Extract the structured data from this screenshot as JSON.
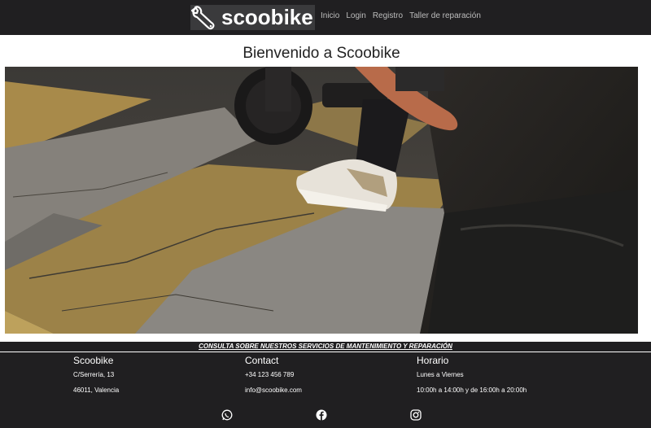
{
  "header": {
    "brand": "scoobike",
    "nav": [
      {
        "label": "Inicio"
      },
      {
        "label": "Login"
      },
      {
        "label": "Registro"
      },
      {
        "label": "Taller de reparación"
      }
    ]
  },
  "main": {
    "title": "Bienvenido a Scoobike"
  },
  "footer": {
    "service_link": "CONSULTA SOBRE NUESTROS SERVICIOS DE MANTENIMIENTO Y REPARACIÓN",
    "columns": [
      {
        "heading": "Scoobike",
        "line1": "C/Serrería, 13",
        "line2": "46011, Valencia"
      },
      {
        "heading": "Contact",
        "line1": "+34 123 456 789",
        "line2": "info@scoobike.com"
      },
      {
        "heading": "Horario",
        "line1": "Lunes a Viernes",
        "line2": "10:00h a 14:00h y de 16:00h a 20:00h"
      }
    ],
    "social_icons": [
      "whatsapp-icon",
      "facebook-icon",
      "instagram-icon"
    ]
  },
  "colors": {
    "header_bg": "#201f21",
    "footer_bg": "#201f21",
    "logo_bg": "#3a3a3c",
    "nav_text": "#bdbdbd"
  }
}
